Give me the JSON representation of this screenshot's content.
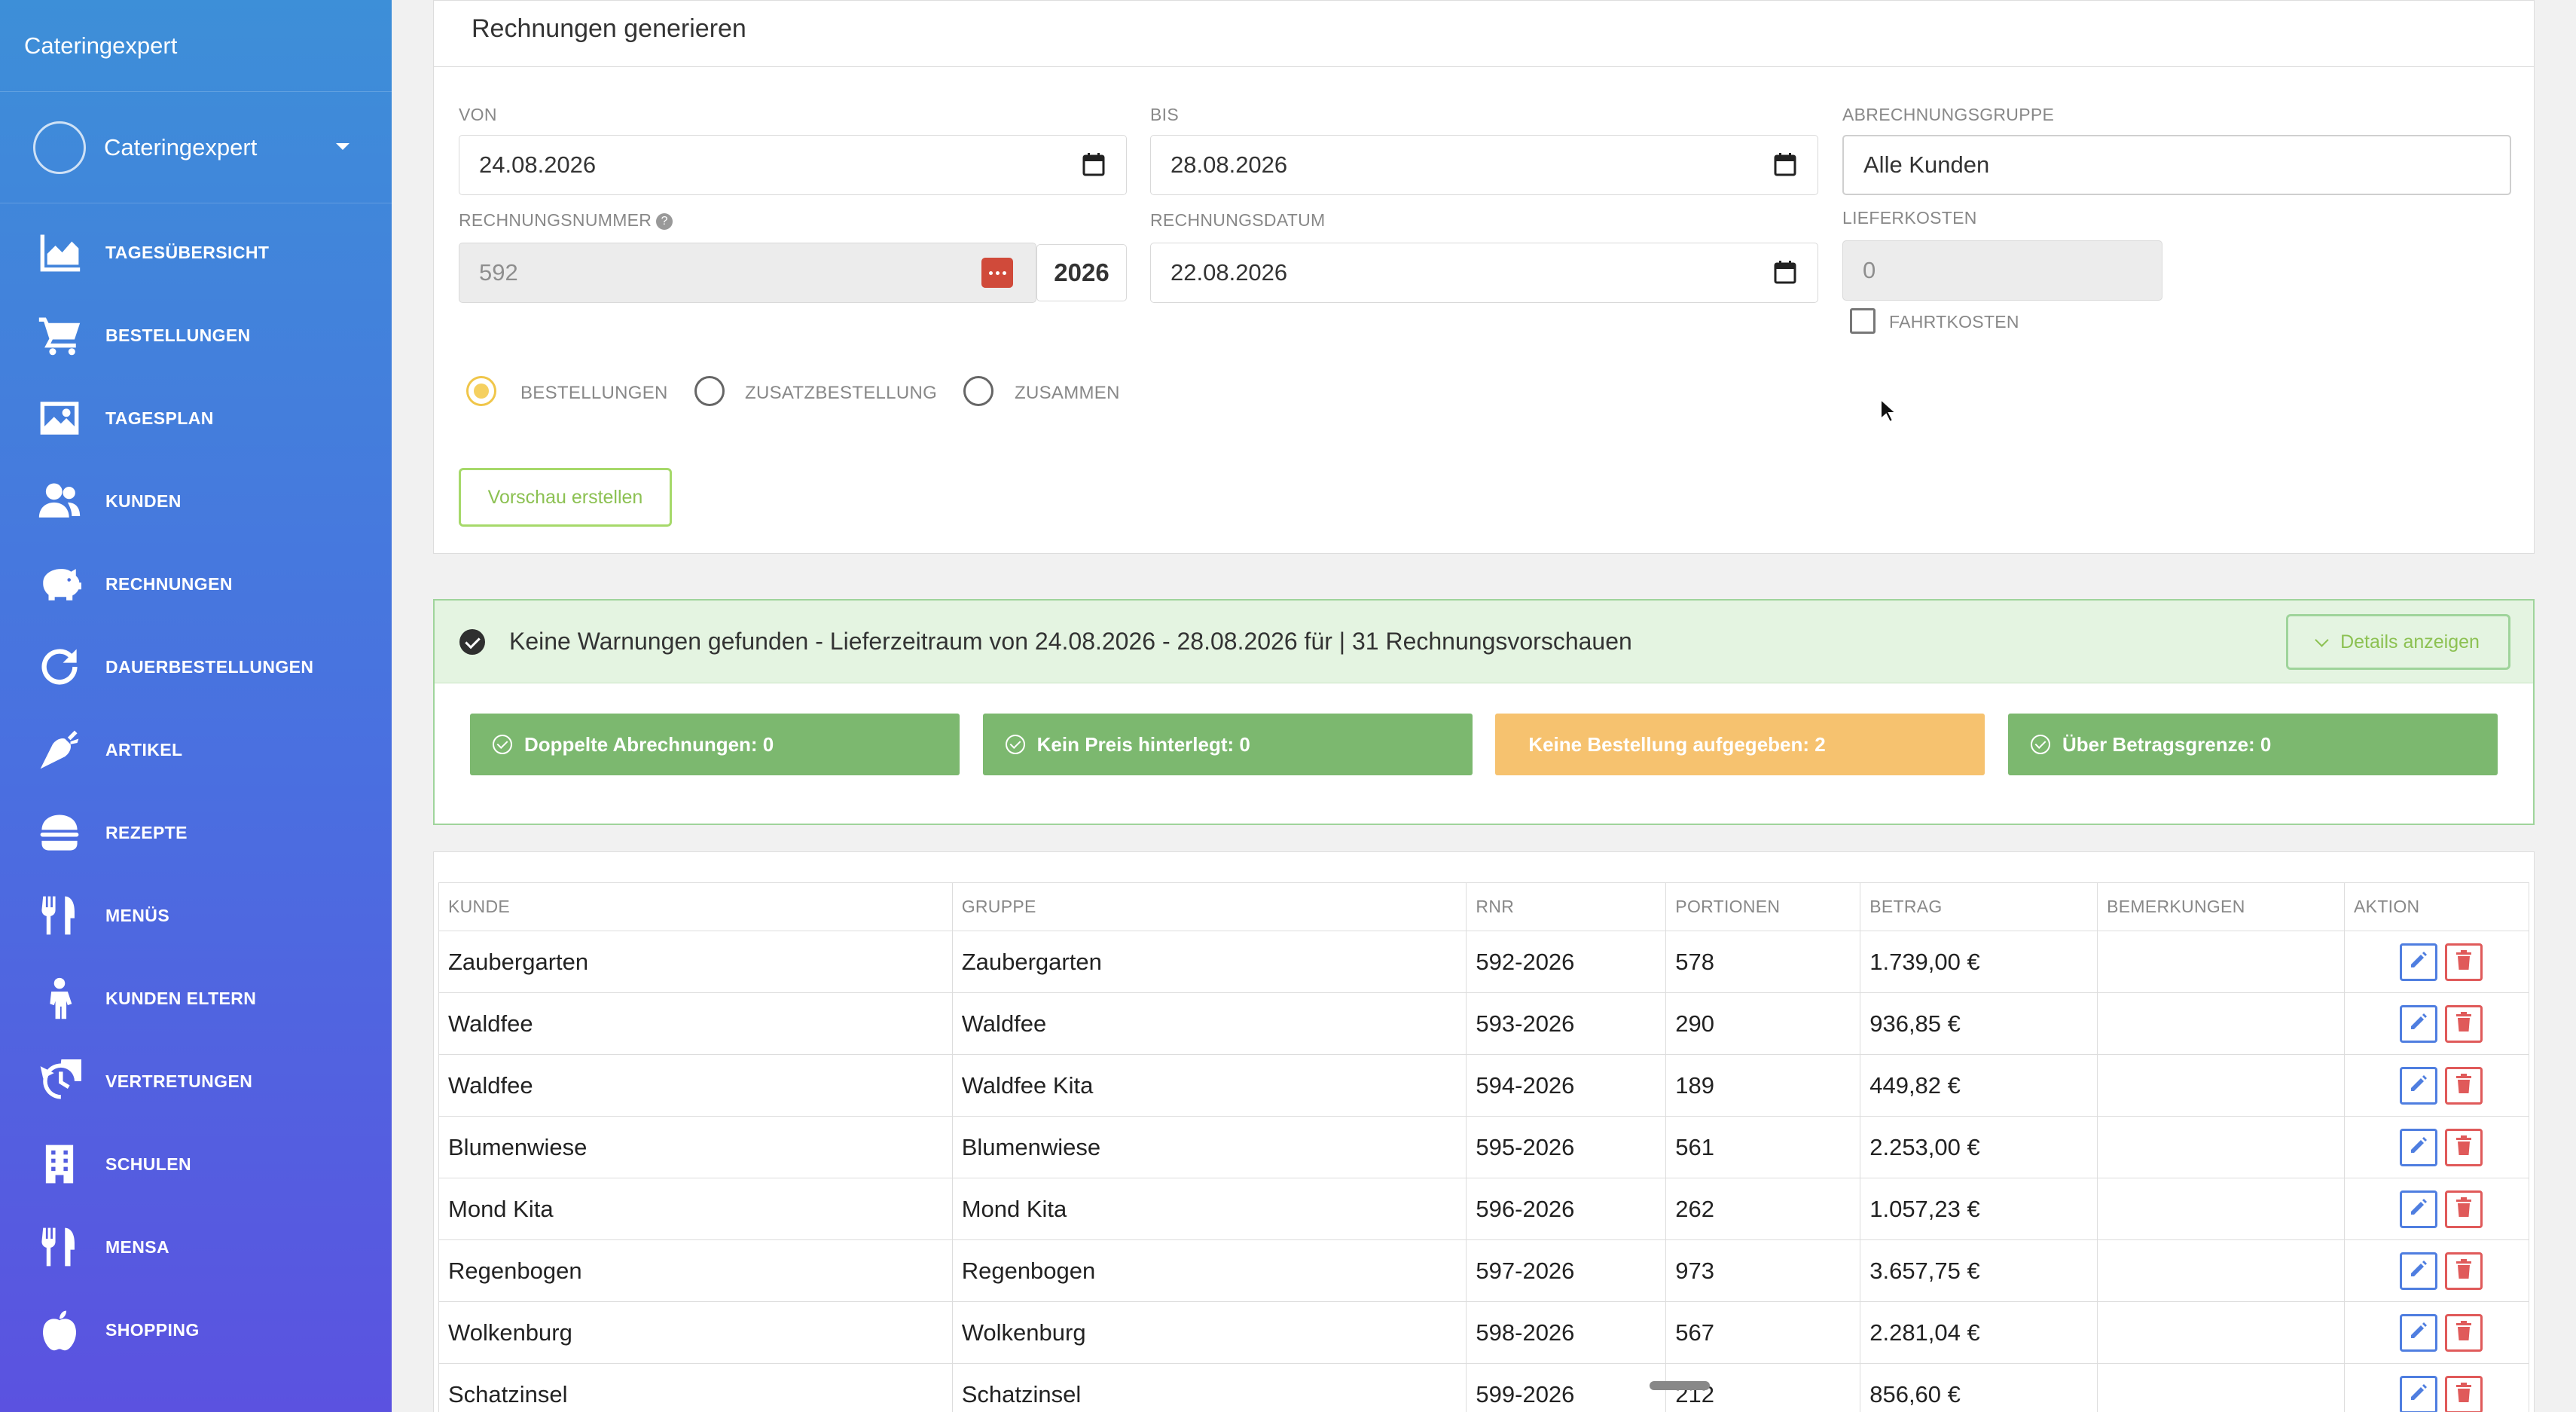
{
  "sidebar": {
    "brand": "Cateringexpert",
    "user_name": "Cateringexpert",
    "items": [
      {
        "label": "TAGESÜBERSICHT",
        "icon": "area-chart-icon"
      },
      {
        "label": "BESTELLUNGEN",
        "icon": "cart-icon"
      },
      {
        "label": "TAGESPLAN",
        "icon": "image-icon"
      },
      {
        "label": "KUNDEN",
        "icon": "users-icon"
      },
      {
        "label": "RECHNUNGEN",
        "icon": "piggy-bank-icon"
      },
      {
        "label": "DAUERBESTELLUNGEN",
        "icon": "redo-icon"
      },
      {
        "label": "ARTIKEL",
        "icon": "carrot-icon"
      },
      {
        "label": "REZEPTE",
        "icon": "burger-icon"
      },
      {
        "label": "MENÜS",
        "icon": "utensils-icon"
      },
      {
        "label": "KUNDEN ELTERN",
        "icon": "child-icon"
      },
      {
        "label": "VERTRETUNGEN",
        "icon": "history-icon"
      },
      {
        "label": "SCHULEN",
        "icon": "building-icon"
      },
      {
        "label": "MENSA",
        "icon": "utensils-icon"
      },
      {
        "label": "SHOPPING",
        "icon": "apple-icon"
      }
    ]
  },
  "form": {
    "title": "Rechnungen generieren",
    "von_label": "VON",
    "von_value": "24.08.2026",
    "bis_label": "BIS",
    "bis_value": "28.08.2026",
    "gruppe_label": "ABRECHNUNGSGRUPPE",
    "gruppe_value": "Alle Kunden",
    "rnr_label": "RECHNUNGSNUMMER",
    "rnr_value": "592",
    "rnr_year": "2026",
    "rdatum_label": "RECHNUNGSDATUM",
    "rdatum_value": "22.08.2026",
    "liefer_label": "LIEFERKOSTEN",
    "liefer_value": "0",
    "fahrt_label": "FAHRTKOSTEN",
    "radios": [
      "BESTELLUNGEN",
      "ZUSATZBESTELLUNG",
      "ZUSAMMEN"
    ],
    "radio_selected": "BESTELLUNGEN",
    "preview_button": "Vorschau erstellen"
  },
  "warnings": {
    "message": "Keine Warnungen gefunden - Lieferzeitraum von 24.08.2026 - 28.08.2026 für | 31 Rechnungsvorschauen",
    "details_button": "Details anzeigen",
    "badges": [
      {
        "label": "Doppelte Abrechnungen: 0",
        "status": "ok"
      },
      {
        "label": "Kein Preis hinterlegt: 0",
        "status": "ok"
      },
      {
        "label": "Keine Bestellung aufgegeben: 2",
        "status": "warn"
      },
      {
        "label": "Über Betragsgrenze: 0",
        "status": "ok"
      }
    ]
  },
  "table": {
    "headers": [
      "KUNDE",
      "GRUPPE",
      "RNR",
      "PORTIONEN",
      "BETRAG",
      "BEMERKUNGEN",
      "AKTION"
    ],
    "rows": [
      [
        "Zaubergarten",
        "Zaubergarten",
        "592-2026",
        "578",
        "1.739,00 €",
        ""
      ],
      [
        "Waldfee",
        "Waldfee",
        "593-2026",
        "290",
        "936,85 €",
        ""
      ],
      [
        "Waldfee",
        "Waldfee Kita",
        "594-2026",
        "189",
        "449,82 €",
        ""
      ],
      [
        "Blumenwiese",
        "Blumenwiese",
        "595-2026",
        "561",
        "2.253,00 €",
        ""
      ],
      [
        "Mond Kita",
        "Mond Kita",
        "596-2026",
        "262",
        "1.057,23 €",
        ""
      ],
      [
        "Regenbogen",
        "Regenbogen",
        "597-2026",
        "973",
        "3.657,75 €",
        ""
      ],
      [
        "Wolkenburg",
        "Wolkenburg",
        "598-2026",
        "567",
        "2.281,04 €",
        ""
      ],
      [
        "Schatzinsel",
        "Schatzinsel",
        "599-2026",
        "212",
        "856,60 €",
        ""
      ]
    ]
  },
  "colors": {
    "sidebar_top": "#3d8fd8",
    "sidebar_bottom": "#5b52e0",
    "success": "#7cb86f",
    "warning": "#f6c26f",
    "edit": "#4f7ee0",
    "delete": "#e05a5a"
  }
}
